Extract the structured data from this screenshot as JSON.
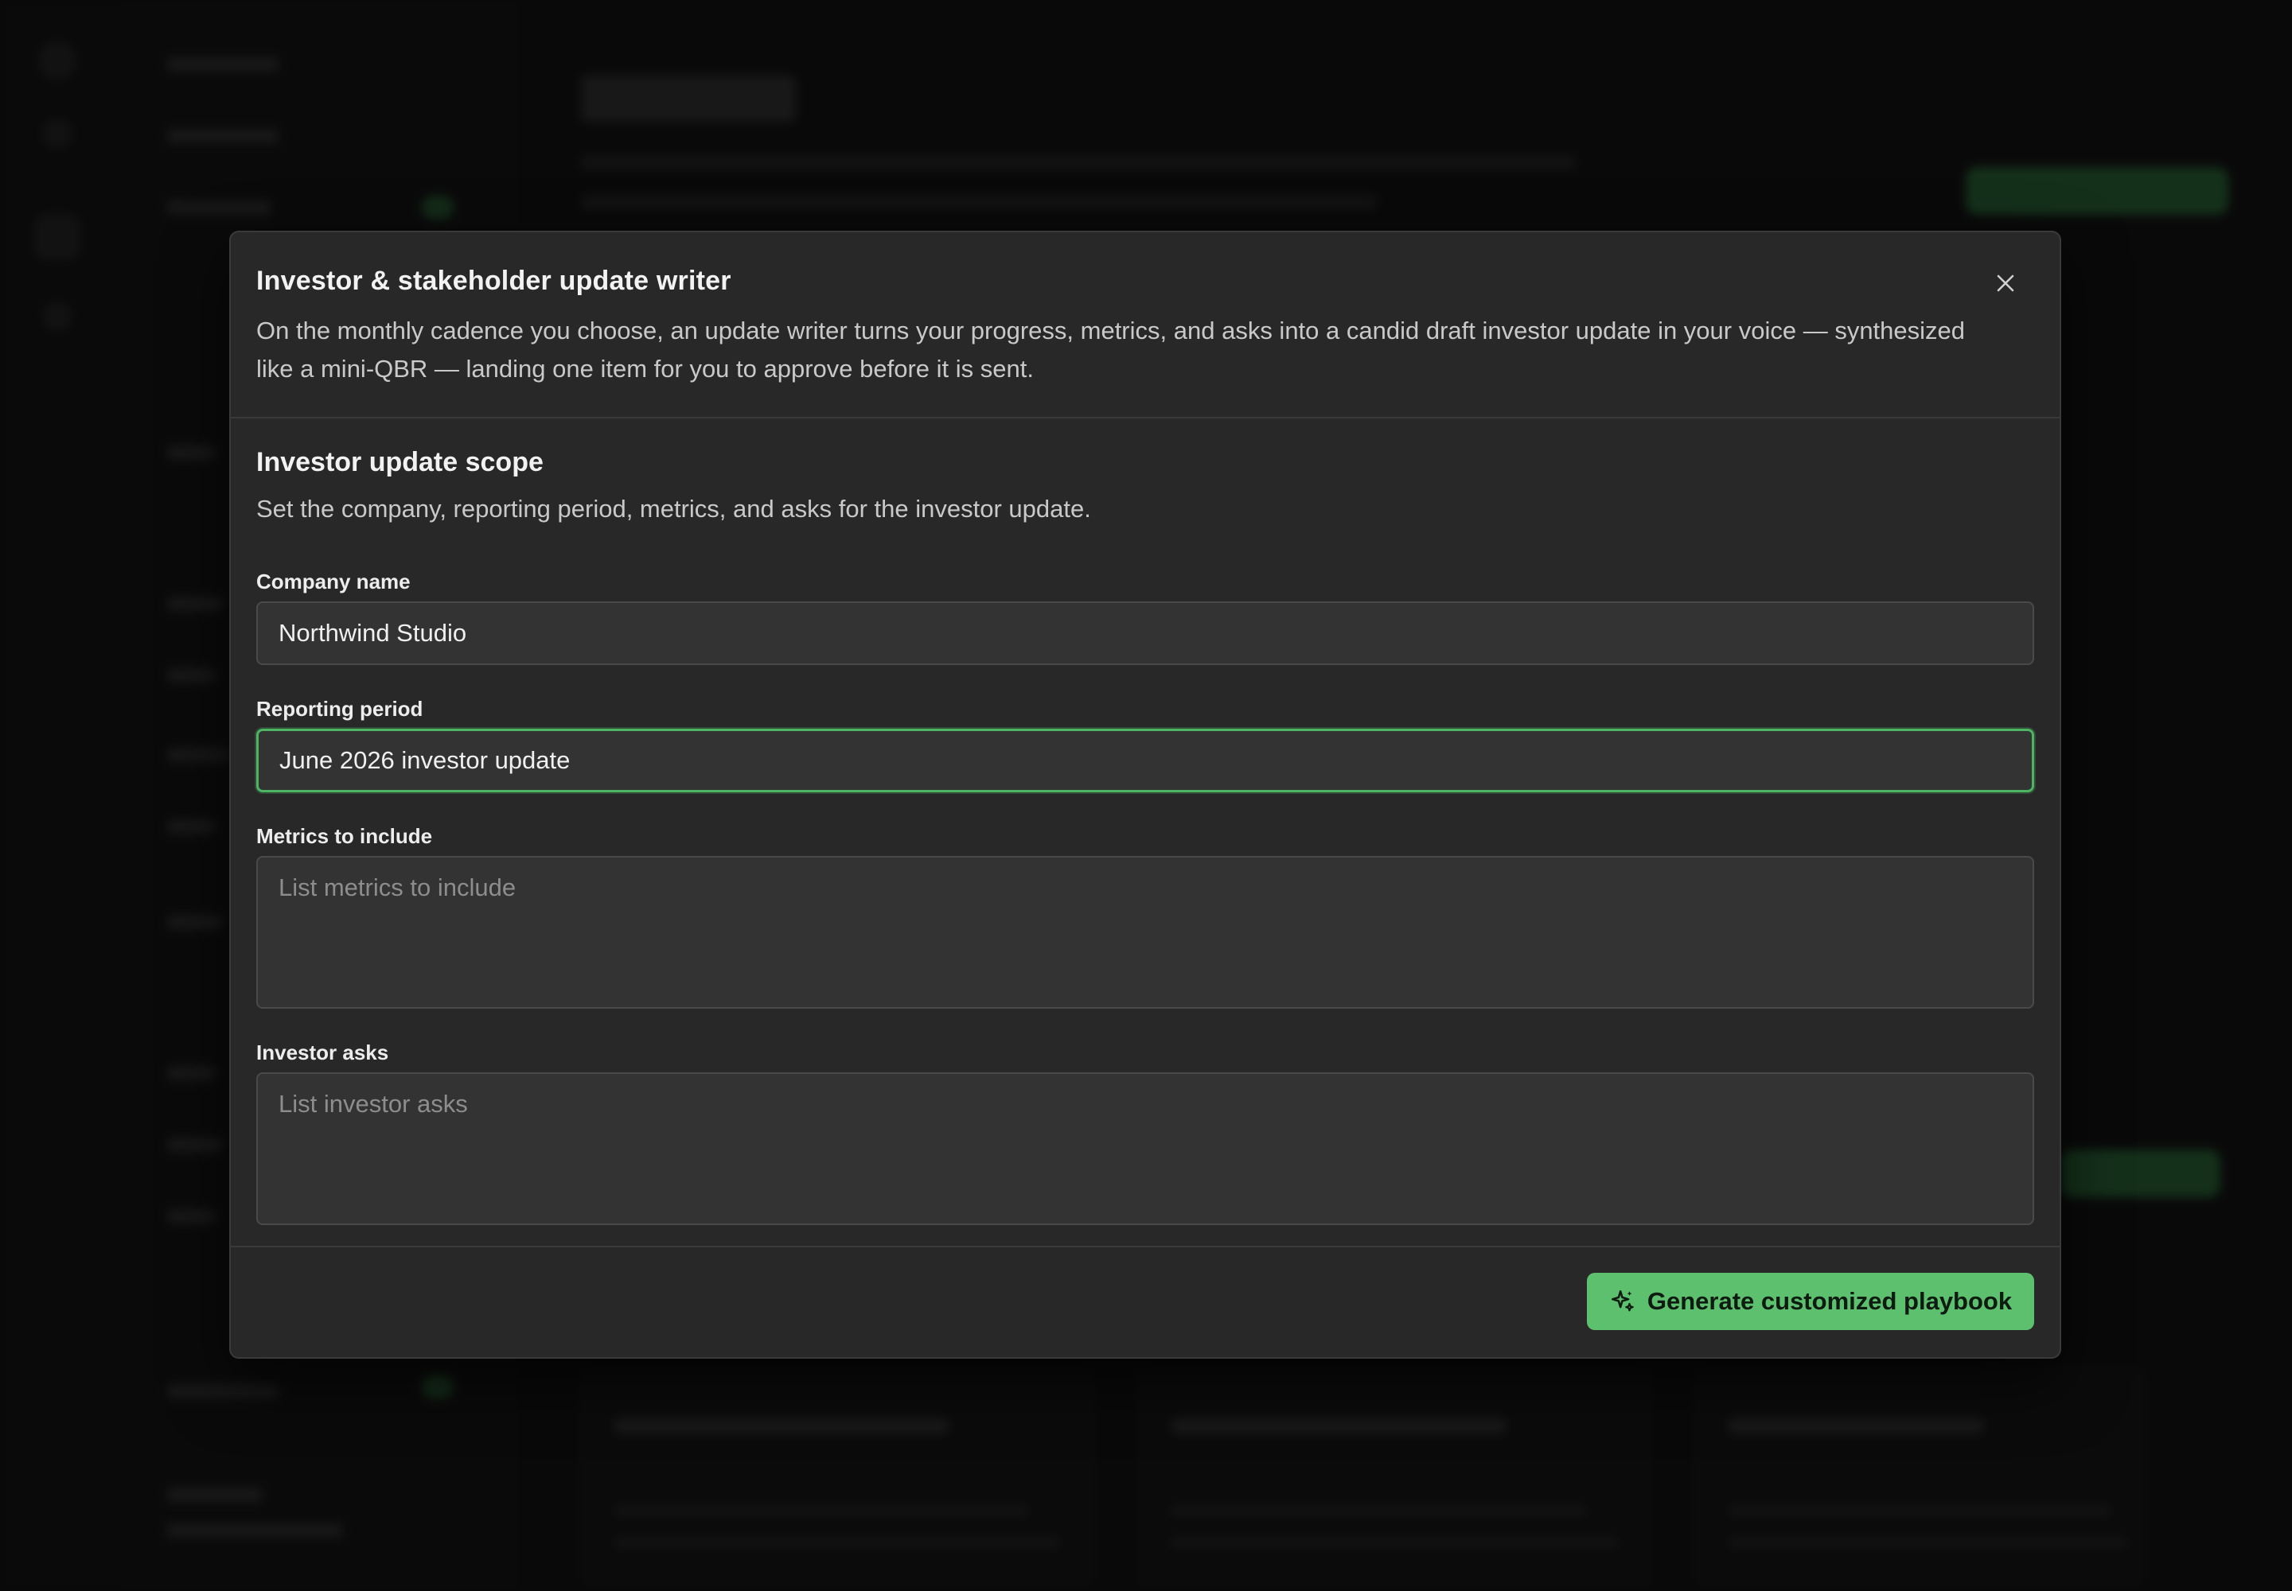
{
  "modal": {
    "title": "Investor & stakeholder update writer",
    "description": "On the monthly cadence you choose, an update writer turns your progress, metrics, and asks into a candid draft investor update in your voice — synthesized like a mini-QBR — landing one item for you to approve before it is sent.",
    "close_icon": "close-icon",
    "section": {
      "title": "Investor update scope",
      "description": "Set the company, reporting period, metrics, and asks for the investor update."
    },
    "fields": {
      "company_name": {
        "label": "Company name",
        "value": "Northwind Studio"
      },
      "reporting_period": {
        "label": "Reporting period",
        "value": "June 2026 investor update"
      },
      "metrics": {
        "label": "Metrics to include",
        "placeholder": "List metrics to include",
        "value": ""
      },
      "investor_asks": {
        "label": "Investor asks",
        "placeholder": "List investor asks",
        "value": ""
      }
    },
    "footer": {
      "generate_label": "Generate customized playbook",
      "generate_icon": "sparkles-icon"
    }
  },
  "colors": {
    "accent": "#5cc06e",
    "focus_border": "#4cb463",
    "modal_bg": "#282828",
    "input_bg": "#333333",
    "page_bg": "#0e0e0e"
  }
}
